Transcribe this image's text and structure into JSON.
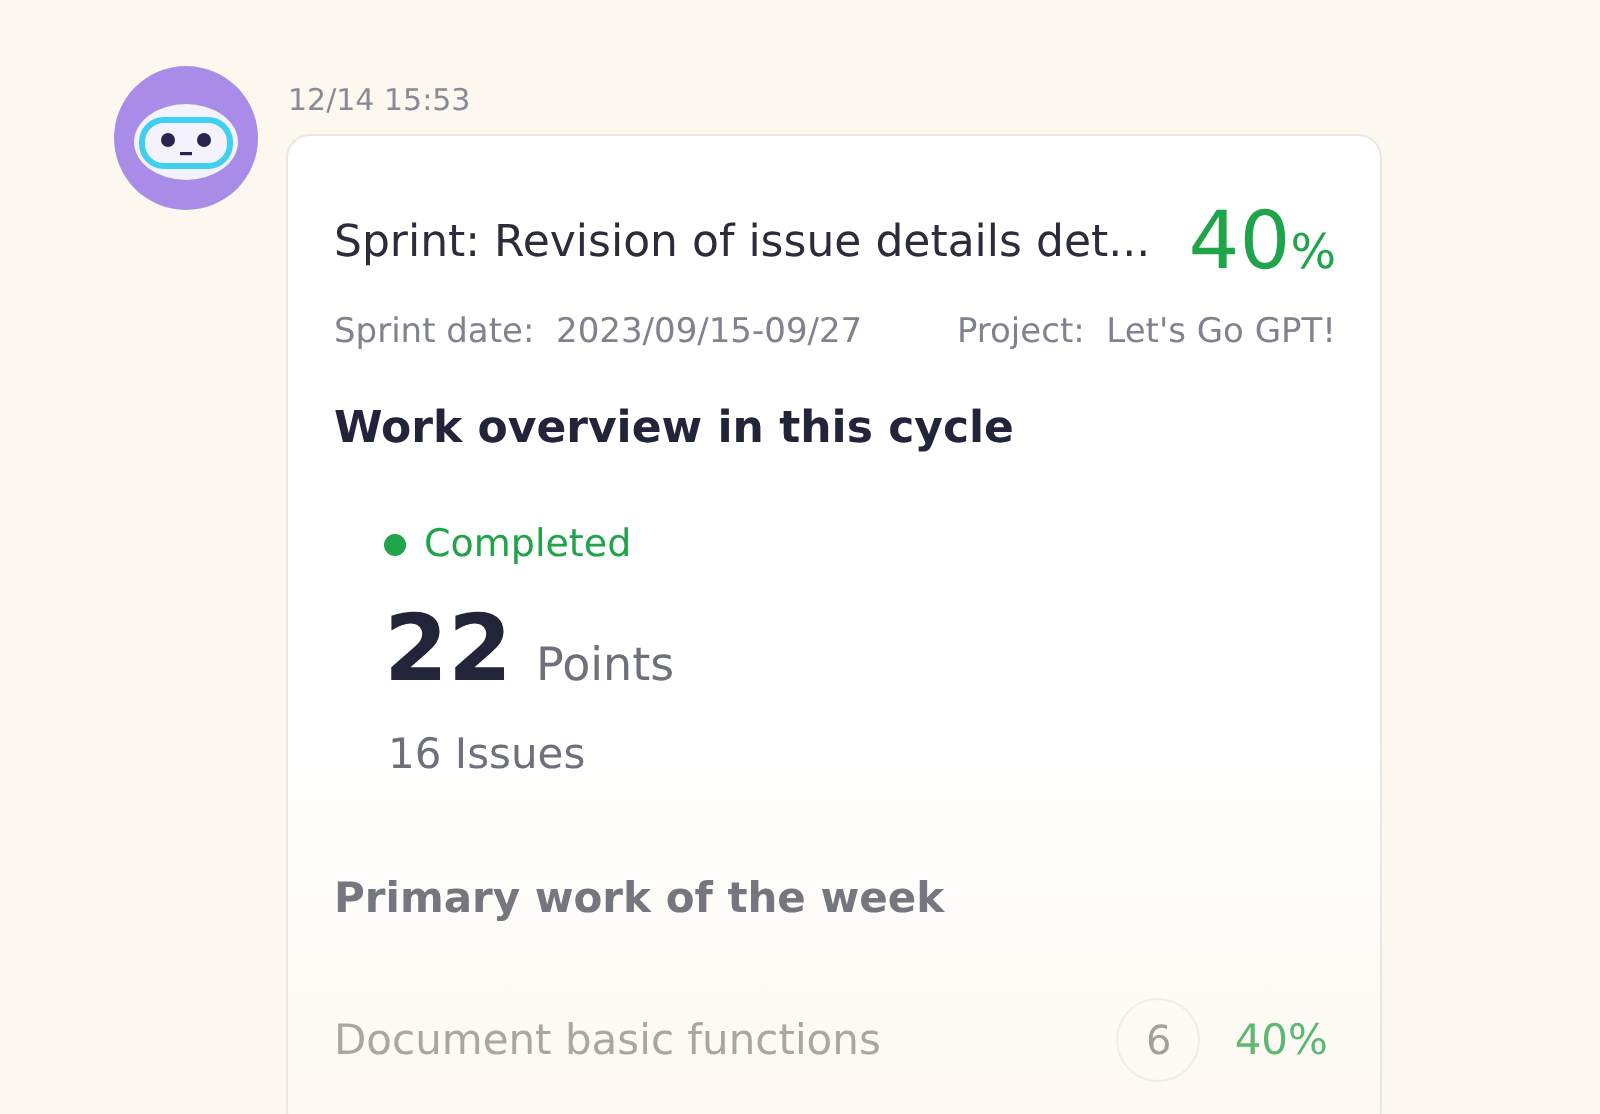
{
  "message": {
    "timestamp": "12/14 15:53",
    "card": {
      "title": "Sprint: Revision of issue details det...",
      "progress": "40",
      "progress_unit": "%",
      "sprint_date_label": "Sprint date:",
      "sprint_date": "2023/09/15-09/27",
      "project_label": "Project:",
      "project": "Let's Go GPT!",
      "overview_heading": "Work overview in this cycle",
      "status": {
        "label": "Completed",
        "color": "#1fa44a"
      },
      "points": "22",
      "points_unit": "Points",
      "issues": "16 Issues",
      "primary_heading": "Primary work of the week",
      "work_items": [
        {
          "name": "Document basic functions",
          "count": "6",
          "percent": "40%"
        }
      ]
    }
  }
}
